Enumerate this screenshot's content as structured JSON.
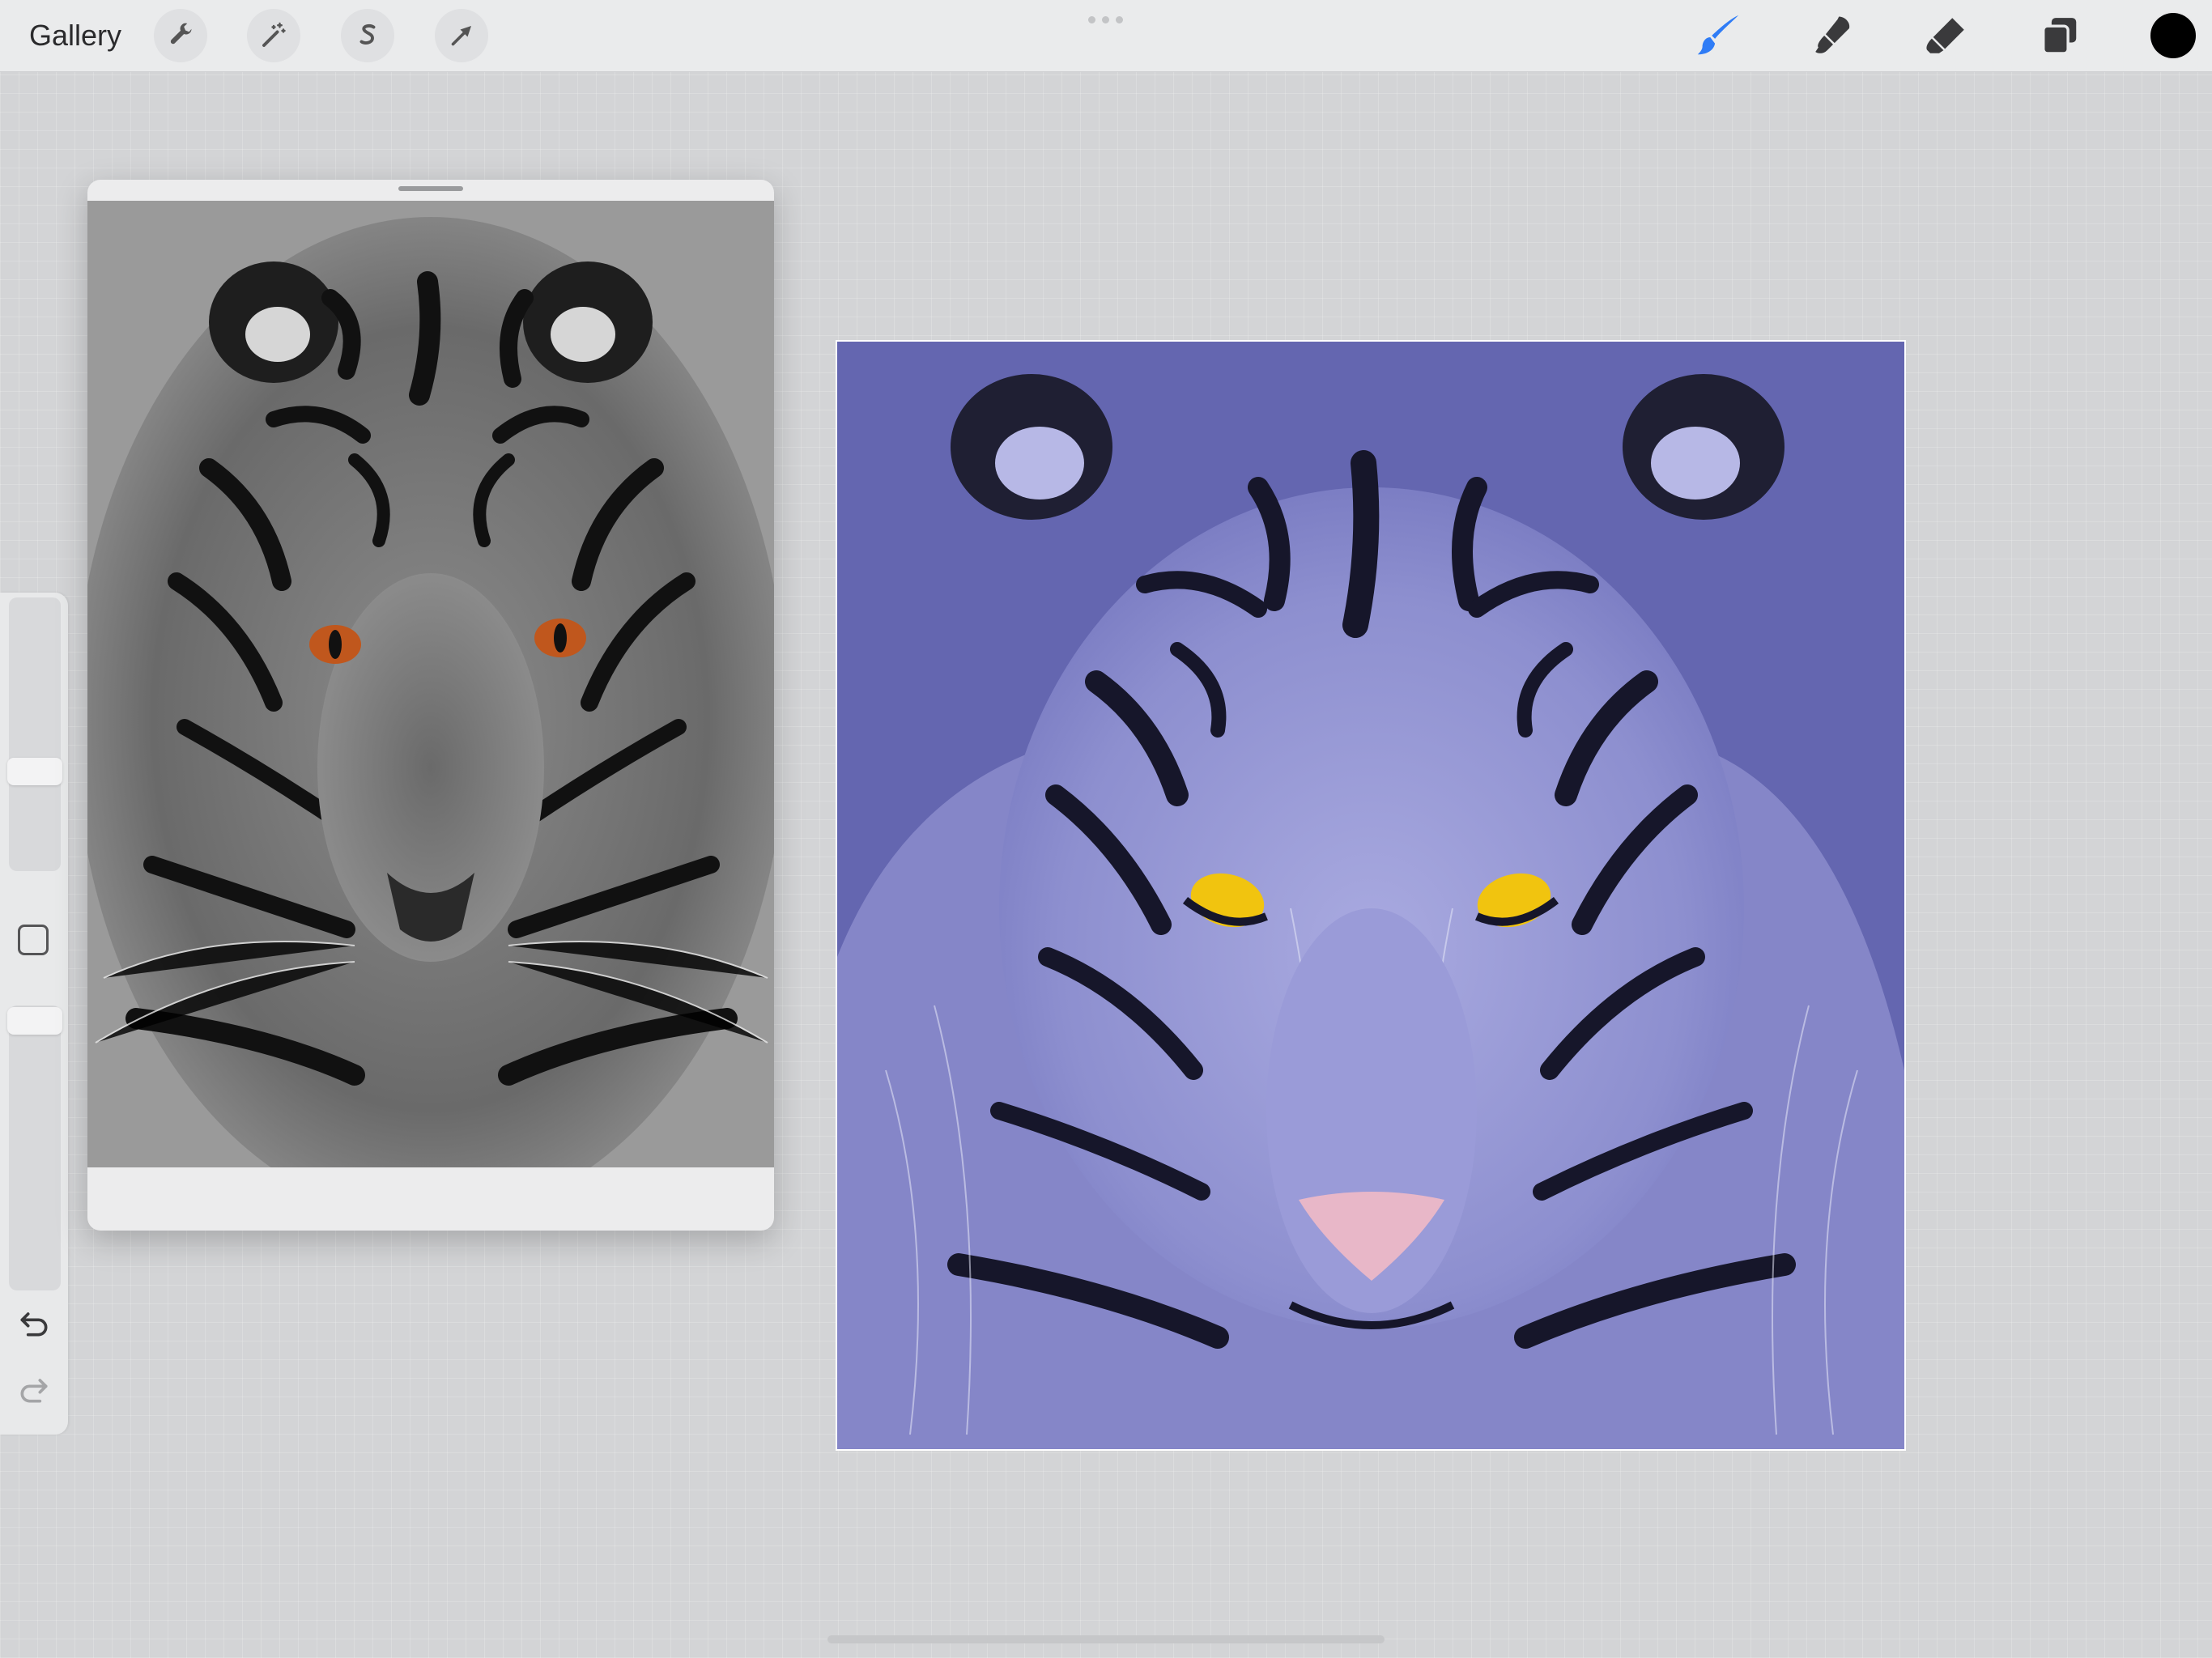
{
  "app": {
    "gallery_label": "Gallery"
  },
  "toolbar_left": {
    "actions_icon": "wrench-icon",
    "adjustments_icon": "magic-wand-icon",
    "selection_icon": "selection-s-icon",
    "transform_icon": "transform-arrow-icon"
  },
  "toolbar_right": {
    "brush_icon": "brush-icon",
    "smudge_icon": "smudge-icon",
    "eraser_icon": "eraser-icon",
    "layers_icon": "layers-icon",
    "active_tool": "brush",
    "current_color": "#000000",
    "accent_color": "#2f7cf6"
  },
  "sidebar": {
    "brush_size_level": 0.62,
    "opacity_level": 0.93,
    "modify_icon": "square-icon",
    "undo_icon": "undo-icon",
    "redo_icon": "redo-icon"
  },
  "reference": {
    "image_desc_icon": "tiger-photo-grayscale"
  },
  "canvas": {
    "background_color": "#6466b0",
    "image_desc_icon": "tiger-painting-purple"
  }
}
